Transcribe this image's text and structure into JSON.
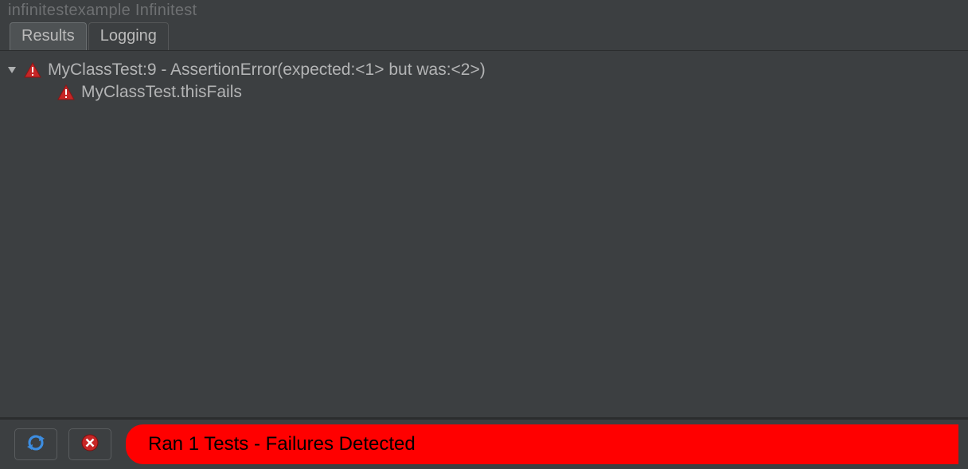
{
  "panel": {
    "title": "infinitestexample Infinitest"
  },
  "tabs": [
    {
      "label": "Results",
      "active": true
    },
    {
      "label": "Logging",
      "active": false
    }
  ],
  "tree": {
    "root": {
      "label": "MyClassTest:9 - AssertionError(expected:<1> but was:<2>)",
      "expanded": true,
      "children": [
        {
          "label": "MyClassTest.thisFails"
        }
      ]
    }
  },
  "status": {
    "message": "Ran 1 Tests - Failures Detected",
    "color": "#ff0000"
  },
  "icons": {
    "warning": "warning-triangle",
    "refresh": "refresh",
    "stop": "stop-error"
  }
}
